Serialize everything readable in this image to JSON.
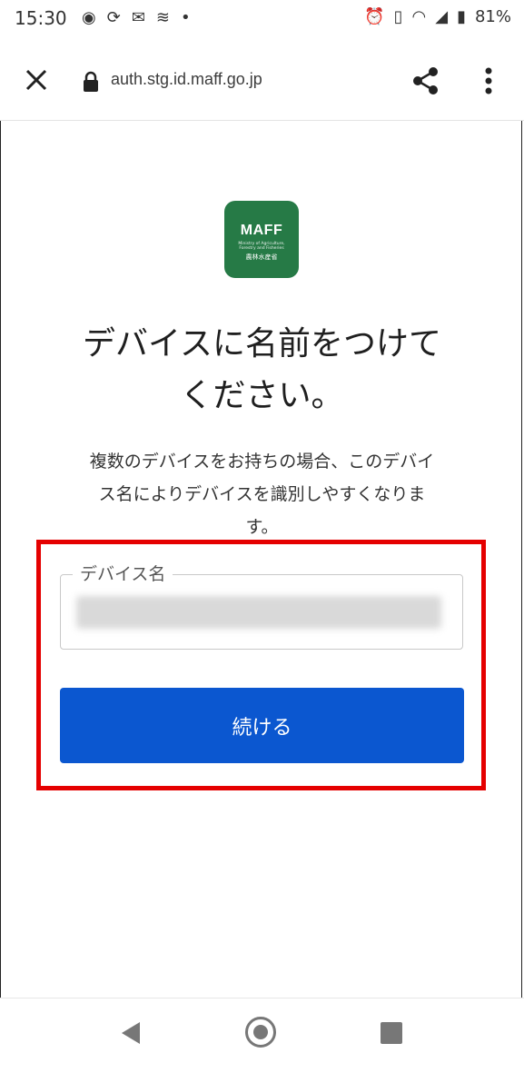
{
  "status_bar": {
    "time": "15:30",
    "battery_percent": "81%",
    "left_icons": [
      "notification-icon",
      "sync-icon",
      "gmail-icon",
      "signal-icon",
      "dot-icon"
    ],
    "right_icons": [
      "alarm-icon",
      "vibrate-icon",
      "wifi-icon",
      "cell-signal-icon",
      "battery-icon"
    ]
  },
  "browser": {
    "url": "auth.stg.id.maff.go.jp"
  },
  "logo": {
    "main": "MAFF",
    "sub": "Ministry of Agriculture, Forestry and Fisheries",
    "kanji": "農林水産省",
    "color": "#267a46"
  },
  "page": {
    "title_line1": "デバイスに名前をつけて",
    "title_line2": "ください。",
    "description_line1": "複数のデバイスをお持ちの場合、このデバイ",
    "description_line2": "ス名によりデバイスを識別しやすくなりま",
    "description_line3": "す。"
  },
  "form": {
    "device_name_label": "デバイス名",
    "continue_label": "続ける"
  },
  "colors": {
    "primary_button": "#0b57d0",
    "highlight_border": "#e50000"
  }
}
